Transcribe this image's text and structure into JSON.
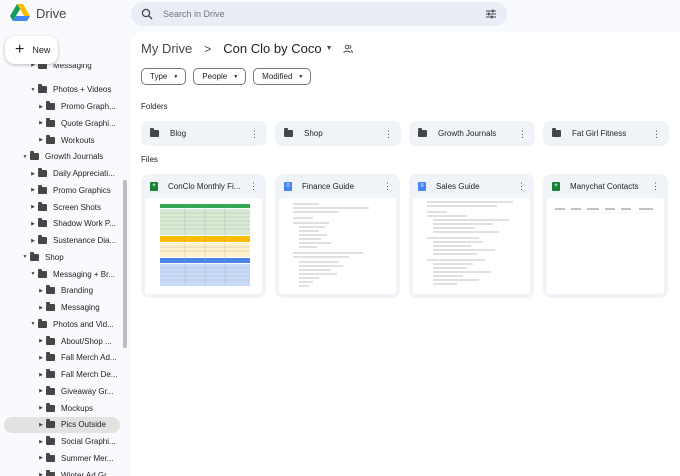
{
  "app": {
    "name": "Drive"
  },
  "search": {
    "placeholder": "Search in Drive"
  },
  "new_button": {
    "label": "New"
  },
  "sidebar": {
    "items": [
      {
        "label": "Messaging",
        "depth": 3,
        "selected": false
      },
      {
        "label": "Photos + Videos",
        "depth": 3,
        "selected": false
      },
      {
        "label": "Promo Graph...",
        "depth": 4,
        "selected": false
      },
      {
        "label": "Quote Graphi...",
        "depth": 4,
        "selected": false
      },
      {
        "label": "Workouts",
        "depth": 4,
        "selected": false
      },
      {
        "label": "Growth Journals",
        "depth": 2,
        "selected": false
      },
      {
        "label": "Daily Appreciati...",
        "depth": 3,
        "selected": false
      },
      {
        "label": "Promo Graphics",
        "depth": 3,
        "selected": false
      },
      {
        "label": "Screen Shots",
        "depth": 3,
        "selected": false
      },
      {
        "label": "Shadow Work P...",
        "depth": 3,
        "selected": false
      },
      {
        "label": "Sustenance Dia...",
        "depth": 3,
        "selected": false
      },
      {
        "label": "Shop",
        "depth": 2,
        "selected": false
      },
      {
        "label": "Messaging + Br...",
        "depth": 3,
        "selected": false
      },
      {
        "label": "Branding",
        "depth": 4,
        "selected": false
      },
      {
        "label": "Messaging",
        "depth": 4,
        "selected": false
      },
      {
        "label": "Photos and Vid...",
        "depth": 3,
        "selected": false
      },
      {
        "label": "About/Shop ...",
        "depth": 4,
        "selected": false
      },
      {
        "label": "Fall Merch Ad...",
        "depth": 4,
        "selected": false
      },
      {
        "label": "Fall Merch De...",
        "depth": 4,
        "selected": false
      },
      {
        "label": "Giveaway Gr...",
        "depth": 4,
        "selected": false
      },
      {
        "label": "Mockups",
        "depth": 4,
        "selected": false
      },
      {
        "label": "Pics Outside",
        "depth": 4,
        "selected": true
      },
      {
        "label": "Social Graphi...",
        "depth": 4,
        "selected": false
      },
      {
        "label": "Summer Mer...",
        "depth": 4,
        "selected": false
      },
      {
        "label": "Winter Ad Gr...",
        "depth": 4,
        "selected": false
      }
    ]
  },
  "breadcrumb": {
    "root": "My Drive",
    "separator": ">",
    "current": "Con Clo by Coco"
  },
  "filters": [
    {
      "label": "Type"
    },
    {
      "label": "People"
    },
    {
      "label": "Modified"
    }
  ],
  "sections": {
    "folders": "Folders",
    "files": "Files"
  },
  "folders": [
    {
      "name": "Blog"
    },
    {
      "name": "Shop"
    },
    {
      "name": "Growth Journals"
    },
    {
      "name": "Fat Girl Fitness"
    }
  ],
  "files": [
    {
      "name": "ConClo Monthly Fi...",
      "type": "sheet"
    },
    {
      "name": "Finance Guide",
      "type": "doc"
    },
    {
      "name": "Sales Guide",
      "type": "doc"
    },
    {
      "name": "Manychat Contacts",
      "type": "sheet"
    }
  ],
  "colors": {
    "accent": "#1a73e8",
    "sheet": "#188038",
    "doc": "#4285f4",
    "surface": "#f0f4f9"
  }
}
